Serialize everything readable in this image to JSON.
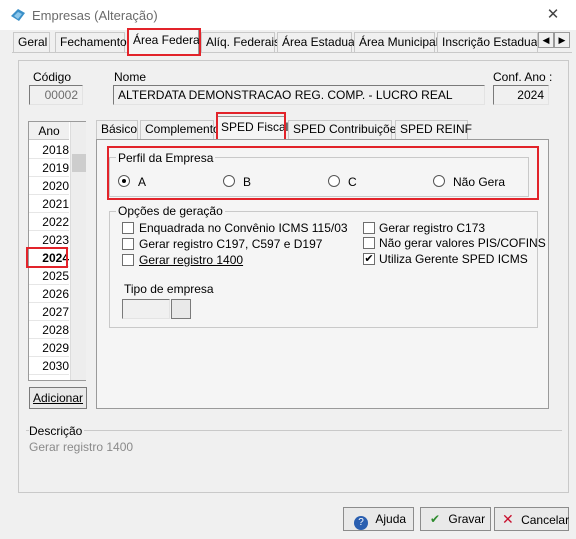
{
  "window": {
    "title": "Empresas (Alteração)",
    "close_glyph": "✕"
  },
  "main_tabs": [
    {
      "label": "Geral"
    },
    {
      "label": "Fechamento"
    },
    {
      "label": "Área Federal"
    },
    {
      "label": "Alíq. Federais"
    },
    {
      "label": "Área Estadual"
    },
    {
      "label": "Área Municipal"
    },
    {
      "label": "Inscrição Estadual S"
    }
  ],
  "tab_scroll": {
    "left": "◀",
    "right": "▶"
  },
  "header": {
    "codigo_label": "Código",
    "codigo_value": "00002",
    "nome_label": "Nome",
    "nome_value": "ALTERDATA DEMONSTRACAO REG. COMP. - LUCRO REAL",
    "conf_ano_label": "Conf. Ano :",
    "conf_ano_value": "2024"
  },
  "years": {
    "header": "Ano",
    "items": [
      "2018",
      "2019",
      "2020",
      "2021",
      "2022",
      "2023",
      "2024",
      "2025",
      "2026",
      "2027",
      "2028",
      "2029",
      "2030"
    ],
    "selected": "2024",
    "add_button": "Adicionar"
  },
  "sub_tabs": [
    {
      "label": "Básico"
    },
    {
      "label": "Complemento"
    },
    {
      "label": "SPED Fiscal"
    },
    {
      "label": "SPED Contribuições"
    },
    {
      "label": "SPED REINF"
    }
  ],
  "perfil": {
    "title": "Perfil da Empresa",
    "options": [
      "A",
      "B",
      "C",
      "Não Gera"
    ],
    "selected": "A"
  },
  "opcoes": {
    "title": "Opções de geração",
    "left": [
      {
        "label": "Enquadrada no Convênio ICMS 115/03",
        "checked": false
      },
      {
        "label": "Gerar registro C197, C597 e D197",
        "checked": false
      },
      {
        "label": "Gerar registro 1400",
        "checked": false
      }
    ],
    "right": [
      {
        "label": "Gerar registro C173",
        "checked": false
      },
      {
        "label": "Não gerar valores PIS/COFINS",
        "checked": false
      },
      {
        "label": "Utiliza Gerente SPED ICMS",
        "checked": true
      }
    ],
    "check_mark": "✔",
    "tipo_label": "Tipo de empresa"
  },
  "descricao": {
    "title": "Descrição",
    "text": "Gerar registro 1400"
  },
  "buttons": {
    "ajuda": "Ajuda",
    "gravar": "Gravar",
    "cancelar": "Cancelar"
  },
  "icons": {
    "help": "?",
    "check": "✔",
    "cancel": "✕"
  },
  "colors": {
    "highlight": "#e2232a",
    "help_blue": "#2a5fb0",
    "gravar_green": "#2e8b2e",
    "cancel_red": "#c8102e",
    "disabled_text": "#8a8a8a"
  }
}
